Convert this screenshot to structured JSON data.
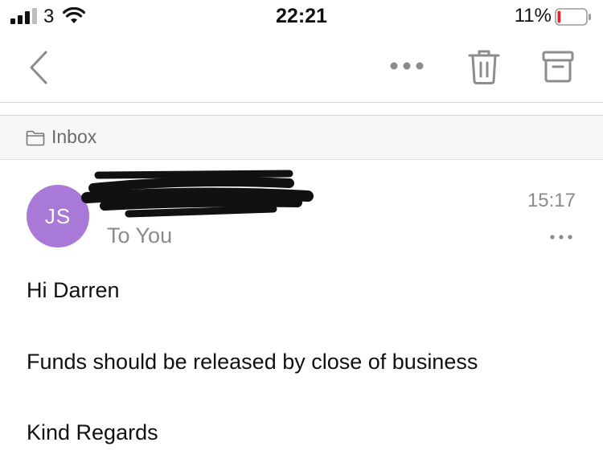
{
  "status_bar": {
    "carrier": "3",
    "time": "22:21",
    "battery_percent": "11%",
    "battery_level": 0.11,
    "icons": [
      "signal-icon",
      "wifi-icon",
      "battery-icon"
    ],
    "battery_low_color": "#e0262b"
  },
  "toolbar": {
    "icons": [
      "back-chevron-icon",
      "more-horizontal-icon",
      "trash-icon",
      "archive-icon"
    ],
    "icon_color": "#8c8c8c"
  },
  "folder": {
    "icon": "folder-icon",
    "label": "Inbox"
  },
  "message": {
    "avatar_initials": "JS",
    "avatar_color": "#a979d8",
    "recipient_line": "To You",
    "time": "15:17",
    "body_lines": [
      "Hi Darren",
      "Funds should be released by close of business",
      "Kind Regards"
    ]
  }
}
